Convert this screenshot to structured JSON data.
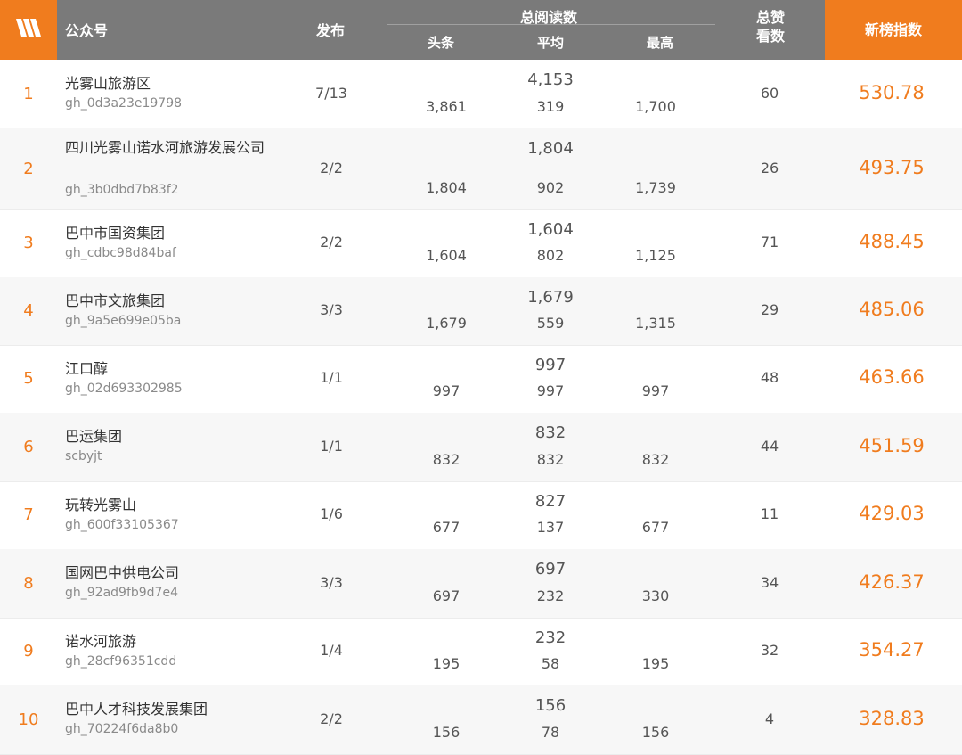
{
  "header": {
    "account_label": "公众号",
    "publish_label": "发布",
    "total_reads_label": "总阅读数",
    "headline_label": "头条",
    "average_label": "平均",
    "max_label": "最高",
    "likes_line1": "总赞",
    "likes_line2": "看数",
    "index_label": "新榜指数"
  },
  "brand": {
    "logo_icon": "logo-icon",
    "accent_color": "#f07c1e",
    "header_color": "#7a7a7a"
  },
  "rows": [
    {
      "rank": "1",
      "name": "光雾山旅游区",
      "id": "gh_0d3a23e19798",
      "publish": "7/13",
      "total": "4,153",
      "headline": "3,861",
      "average": "319",
      "max": "1,700",
      "likes": "60",
      "index": "530.78"
    },
    {
      "rank": "2",
      "name": "四川光雾山诺水河旅游发展公司",
      "id": "gh_3b0dbd7b83f2",
      "publish": "2/2",
      "total": "1,804",
      "headline": "1,804",
      "average": "902",
      "max": "1,739",
      "likes": "26",
      "index": "493.75"
    },
    {
      "rank": "3",
      "name": "巴中市国资集团",
      "id": "gh_cdbc98d84baf",
      "publish": "2/2",
      "total": "1,604",
      "headline": "1,604",
      "average": "802",
      "max": "1,125",
      "likes": "71",
      "index": "488.45"
    },
    {
      "rank": "4",
      "name": "巴中市文旅集团",
      "id": "gh_9a5e699e05ba",
      "publish": "3/3",
      "total": "1,679",
      "headline": "1,679",
      "average": "559",
      "max": "1,315",
      "likes": "29",
      "index": "485.06"
    },
    {
      "rank": "5",
      "name": "江口醇",
      "id": "gh_02d693302985",
      "publish": "1/1",
      "total": "997",
      "headline": "997",
      "average": "997",
      "max": "997",
      "likes": "48",
      "index": "463.66"
    },
    {
      "rank": "6",
      "name": "巴运集团",
      "id": "scbyjt",
      "publish": "1/1",
      "total": "832",
      "headline": "832",
      "average": "832",
      "max": "832",
      "likes": "44",
      "index": "451.59"
    },
    {
      "rank": "7",
      "name": "玩转光雾山",
      "id": "gh_600f33105367",
      "publish": "1/6",
      "total": "827",
      "headline": "677",
      "average": "137",
      "max": "677",
      "likes": "11",
      "index": "429.03"
    },
    {
      "rank": "8",
      "name": "国网巴中供电公司",
      "id": "gh_92ad9fb9d7e4",
      "publish": "3/3",
      "total": "697",
      "headline": "697",
      "average": "232",
      "max": "330",
      "likes": "34",
      "index": "426.37"
    },
    {
      "rank": "9",
      "name": "诺水河旅游",
      "id": "gh_28cf96351cdd",
      "publish": "1/4",
      "total": "232",
      "headline": "195",
      "average": "58",
      "max": "195",
      "likes": "32",
      "index": "354.27"
    },
    {
      "rank": "10",
      "name": "巴中人才科技发展集团",
      "id": "gh_70224f6da8b0",
      "publish": "2/2",
      "total": "156",
      "headline": "156",
      "average": "78",
      "max": "156",
      "likes": "4",
      "index": "328.83"
    }
  ]
}
